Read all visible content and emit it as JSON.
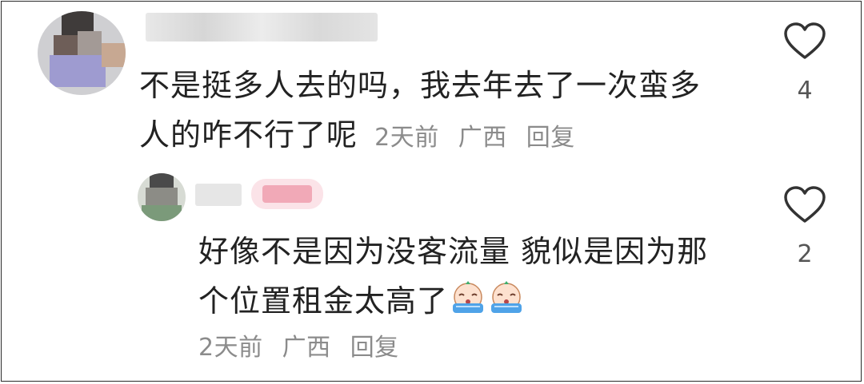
{
  "comments": [
    {
      "text_line1": "不是挺多人去的吗，我去年去了一次蛮多",
      "text_line2": "人的咋不行了呢",
      "time": "2天前",
      "location": "广西",
      "reply_label": "回复",
      "likes": "4",
      "icon": "heart-outline-icon"
    },
    {
      "text_line1": "好像不是因为没客流量 貌似是因为那",
      "text_line2": "个位置租金太高了",
      "time": "2天前",
      "location": "广西",
      "reply_label": "回复",
      "likes": "2",
      "icon": "heart-outline-icon",
      "emojis": [
        "crying-emoji",
        "crying-emoji"
      ]
    }
  ],
  "colors": {
    "text": "#222222",
    "meta": "#8b8b8b",
    "icon_stroke": "#333333",
    "emoji_blue": "#4fa3e8"
  }
}
